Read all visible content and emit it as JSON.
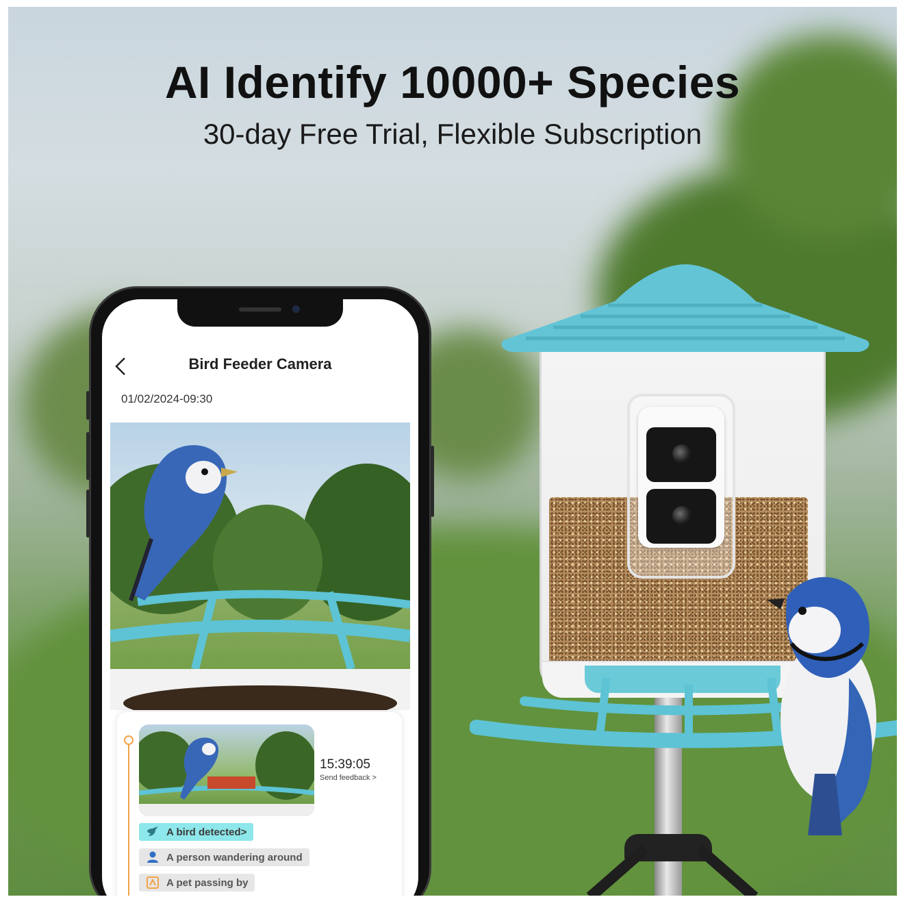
{
  "headline": "AI Identify 10000+ Species",
  "subheadline": "30-day Free Trial, Flexible Subscription",
  "app": {
    "title": "Bird Feeder Camera",
    "back_icon": "chevron-left-icon",
    "timestamp": "01/02/2024-09:30"
  },
  "event": {
    "time": "15:39:05",
    "feedback_link": "Send feedback >",
    "detections": [
      {
        "label": "A bird detected>",
        "icon": "bird-icon",
        "active": true
      },
      {
        "label": "A person wandering around",
        "icon": "person-icon",
        "active": false
      },
      {
        "label": "A pet passing by",
        "icon": "pet-icon",
        "active": false
      }
    ]
  },
  "colors": {
    "accent_teal": "#5fc6d6",
    "timeline_orange": "#f2a346",
    "active_chip": "#8ee7ea"
  }
}
